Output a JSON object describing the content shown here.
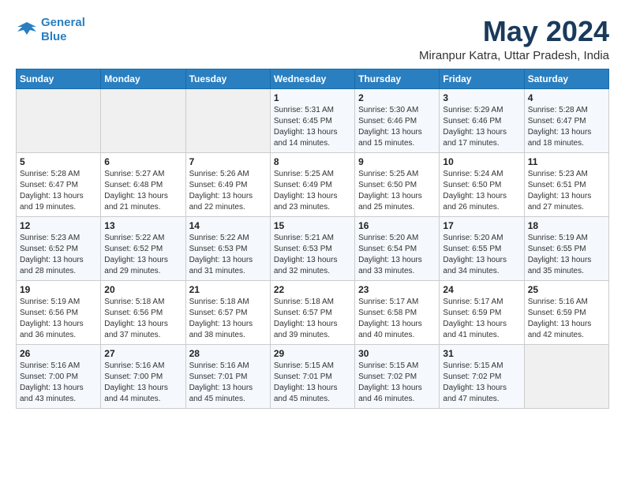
{
  "header": {
    "logo_line1": "General",
    "logo_line2": "Blue",
    "title": "May 2024",
    "subtitle": "Miranpur Katra, Uttar Pradesh, India"
  },
  "weekdays": [
    "Sunday",
    "Monday",
    "Tuesday",
    "Wednesday",
    "Thursday",
    "Friday",
    "Saturday"
  ],
  "weeks": [
    [
      {
        "day": "",
        "info": ""
      },
      {
        "day": "",
        "info": ""
      },
      {
        "day": "",
        "info": ""
      },
      {
        "day": "1",
        "info": "Sunrise: 5:31 AM\nSunset: 6:45 PM\nDaylight: 13 hours\nand 14 minutes."
      },
      {
        "day": "2",
        "info": "Sunrise: 5:30 AM\nSunset: 6:46 PM\nDaylight: 13 hours\nand 15 minutes."
      },
      {
        "day": "3",
        "info": "Sunrise: 5:29 AM\nSunset: 6:46 PM\nDaylight: 13 hours\nand 17 minutes."
      },
      {
        "day": "4",
        "info": "Sunrise: 5:28 AM\nSunset: 6:47 PM\nDaylight: 13 hours\nand 18 minutes."
      }
    ],
    [
      {
        "day": "5",
        "info": "Sunrise: 5:28 AM\nSunset: 6:47 PM\nDaylight: 13 hours\nand 19 minutes."
      },
      {
        "day": "6",
        "info": "Sunrise: 5:27 AM\nSunset: 6:48 PM\nDaylight: 13 hours\nand 21 minutes."
      },
      {
        "day": "7",
        "info": "Sunrise: 5:26 AM\nSunset: 6:49 PM\nDaylight: 13 hours\nand 22 minutes."
      },
      {
        "day": "8",
        "info": "Sunrise: 5:25 AM\nSunset: 6:49 PM\nDaylight: 13 hours\nand 23 minutes."
      },
      {
        "day": "9",
        "info": "Sunrise: 5:25 AM\nSunset: 6:50 PM\nDaylight: 13 hours\nand 25 minutes."
      },
      {
        "day": "10",
        "info": "Sunrise: 5:24 AM\nSunset: 6:50 PM\nDaylight: 13 hours\nand 26 minutes."
      },
      {
        "day": "11",
        "info": "Sunrise: 5:23 AM\nSunset: 6:51 PM\nDaylight: 13 hours\nand 27 minutes."
      }
    ],
    [
      {
        "day": "12",
        "info": "Sunrise: 5:23 AM\nSunset: 6:52 PM\nDaylight: 13 hours\nand 28 minutes."
      },
      {
        "day": "13",
        "info": "Sunrise: 5:22 AM\nSunset: 6:52 PM\nDaylight: 13 hours\nand 29 minutes."
      },
      {
        "day": "14",
        "info": "Sunrise: 5:22 AM\nSunset: 6:53 PM\nDaylight: 13 hours\nand 31 minutes."
      },
      {
        "day": "15",
        "info": "Sunrise: 5:21 AM\nSunset: 6:53 PM\nDaylight: 13 hours\nand 32 minutes."
      },
      {
        "day": "16",
        "info": "Sunrise: 5:20 AM\nSunset: 6:54 PM\nDaylight: 13 hours\nand 33 minutes."
      },
      {
        "day": "17",
        "info": "Sunrise: 5:20 AM\nSunset: 6:55 PM\nDaylight: 13 hours\nand 34 minutes."
      },
      {
        "day": "18",
        "info": "Sunrise: 5:19 AM\nSunset: 6:55 PM\nDaylight: 13 hours\nand 35 minutes."
      }
    ],
    [
      {
        "day": "19",
        "info": "Sunrise: 5:19 AM\nSunset: 6:56 PM\nDaylight: 13 hours\nand 36 minutes."
      },
      {
        "day": "20",
        "info": "Sunrise: 5:18 AM\nSunset: 6:56 PM\nDaylight: 13 hours\nand 37 minutes."
      },
      {
        "day": "21",
        "info": "Sunrise: 5:18 AM\nSunset: 6:57 PM\nDaylight: 13 hours\nand 38 minutes."
      },
      {
        "day": "22",
        "info": "Sunrise: 5:18 AM\nSunset: 6:57 PM\nDaylight: 13 hours\nand 39 minutes."
      },
      {
        "day": "23",
        "info": "Sunrise: 5:17 AM\nSunset: 6:58 PM\nDaylight: 13 hours\nand 40 minutes."
      },
      {
        "day": "24",
        "info": "Sunrise: 5:17 AM\nSunset: 6:59 PM\nDaylight: 13 hours\nand 41 minutes."
      },
      {
        "day": "25",
        "info": "Sunrise: 5:16 AM\nSunset: 6:59 PM\nDaylight: 13 hours\nand 42 minutes."
      }
    ],
    [
      {
        "day": "26",
        "info": "Sunrise: 5:16 AM\nSunset: 7:00 PM\nDaylight: 13 hours\nand 43 minutes."
      },
      {
        "day": "27",
        "info": "Sunrise: 5:16 AM\nSunset: 7:00 PM\nDaylight: 13 hours\nand 44 minutes."
      },
      {
        "day": "28",
        "info": "Sunrise: 5:16 AM\nSunset: 7:01 PM\nDaylight: 13 hours\nand 45 minutes."
      },
      {
        "day": "29",
        "info": "Sunrise: 5:15 AM\nSunset: 7:01 PM\nDaylight: 13 hours\nand 45 minutes."
      },
      {
        "day": "30",
        "info": "Sunrise: 5:15 AM\nSunset: 7:02 PM\nDaylight: 13 hours\nand 46 minutes."
      },
      {
        "day": "31",
        "info": "Sunrise: 5:15 AM\nSunset: 7:02 PM\nDaylight: 13 hours\nand 47 minutes."
      },
      {
        "day": "",
        "info": ""
      }
    ]
  ]
}
